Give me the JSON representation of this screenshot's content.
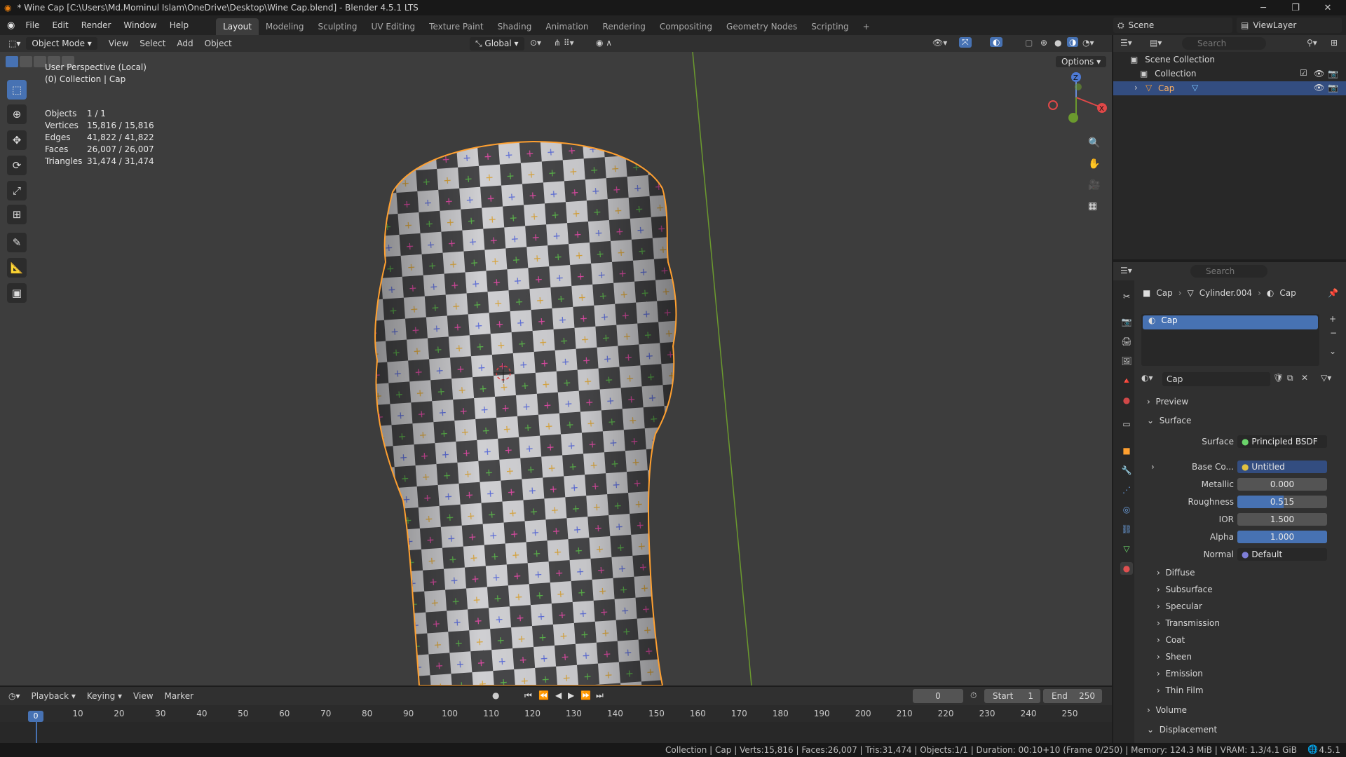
{
  "window": {
    "title": "* Wine Cap [C:\\Users\\Md.Mominul Islam\\OneDrive\\Desktop\\Wine Cap.blend] - Blender 4.5.1 LTS"
  },
  "menu": [
    "File",
    "Edit",
    "Render",
    "Window",
    "Help"
  ],
  "workspaces": [
    "Layout",
    "Modeling",
    "Sculpting",
    "UV Editing",
    "Texture Paint",
    "Shading",
    "Animation",
    "Rendering",
    "Compositing",
    "Geometry Nodes",
    "Scripting"
  ],
  "active_workspace": "Layout",
  "scene": {
    "scene_name": "Scene",
    "view_layer": "ViewLayer"
  },
  "viewport_header": {
    "mode": "Object Mode",
    "menus": [
      "View",
      "Select",
      "Add",
      "Object"
    ],
    "transform_orientation": "Global",
    "options_label": "Options"
  },
  "viewport": {
    "perspective": "User Perspective (Local)",
    "collection_info": "(0) Collection | Cap",
    "stats": [
      {
        "label": "Objects",
        "value": "1 / 1"
      },
      {
        "label": "Vertices",
        "value": "15,816 / 15,816"
      },
      {
        "label": "Edges",
        "value": "41,822 / 41,822"
      },
      {
        "label": "Faces",
        "value": "26,007 / 26,007"
      },
      {
        "label": "Triangles",
        "value": "31,474 / 31,474"
      }
    ],
    "gizmo_axes": {
      "z": "Z",
      "x": "X"
    }
  },
  "outliner": {
    "search_placeholder": "Search",
    "root": "Scene Collection",
    "collection": "Collection",
    "object": "Cap"
  },
  "properties": {
    "search_placeholder": "Search",
    "breadcrumb": [
      "Cap",
      "Cylinder.004",
      "Cap"
    ],
    "material_slot": "Cap",
    "material_name": "Cap",
    "sections": {
      "preview": "Preview",
      "surface": "Surface",
      "diffuse": "Diffuse",
      "subsurface": "Subsurface",
      "specular": "Specular",
      "transmission": "Transmission",
      "coat": "Coat",
      "sheen": "Sheen",
      "emission": "Emission",
      "thin_film": "Thin Film",
      "volume": "Volume",
      "displacement": "Displacement"
    },
    "fields": {
      "surface_label": "Surface",
      "surface_value": "Principled BSDF",
      "base_color_label": "Base Co...",
      "base_color_value": "Untitled",
      "metallic_label": "Metallic",
      "metallic_value": "0.000",
      "roughness_label": "Roughness",
      "roughness_value": "0.515",
      "roughness_fraction": 0.515,
      "ior_label": "IOR",
      "ior_value": "1.500",
      "alpha_label": "Alpha",
      "alpha_value": "1.000",
      "alpha_fraction": 1.0,
      "normal_label": "Normal",
      "normal_value": "Default"
    }
  },
  "timeline": {
    "menus": [
      "Playback",
      "Keying",
      "View",
      "Marker"
    ],
    "current_frame": "0",
    "start_label": "Start",
    "start_value": "1",
    "end_label": "End",
    "end_value": "250",
    "ticks": [
      "0",
      "10",
      "20",
      "30",
      "40",
      "50",
      "60",
      "70",
      "80",
      "90",
      "100",
      "110",
      "120",
      "130",
      "140",
      "150",
      "160",
      "170",
      "180",
      "190",
      "200",
      "210",
      "220",
      "230",
      "240",
      "250"
    ],
    "playhead_label": "0"
  },
  "status_bar": {
    "text": "Collection | Cap | Verts:15,816 | Faces:26,007 | Tris:31,474 | Objects:1/1 | Duration: 00:10+10 (Frame 0/250) | Memory: 124.3 MiB | VRAM: 1.3/4.1 GiB",
    "version": "4.5.1"
  },
  "colors": {
    "accent": "#4772b3",
    "selection_outline": "#ffa030",
    "viewport_bg": "#3d3d3d"
  }
}
